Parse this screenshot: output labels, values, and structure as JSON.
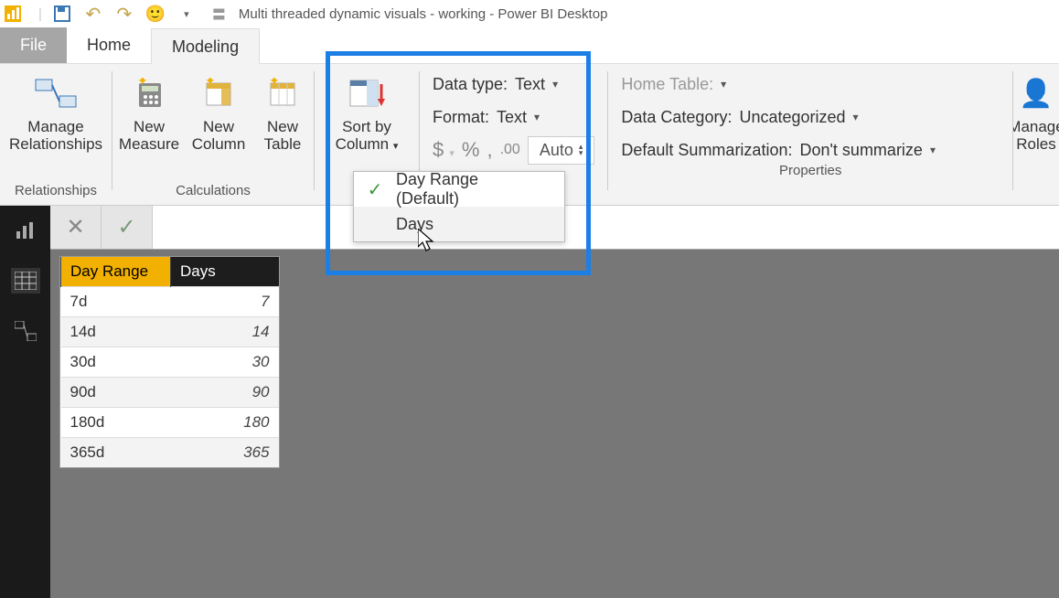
{
  "title": "Multi threaded dynamic visuals - working - Power BI Desktop",
  "tabs": {
    "file": "File",
    "home": "Home",
    "modeling": "Modeling"
  },
  "ribbon": {
    "relationships": {
      "manage": "Manage\nRelationships",
      "group": "Relationships"
    },
    "calculations": {
      "new_measure": "New\nMeasure",
      "new_column": "New\nColumn",
      "new_table": "New\nTable",
      "group": "Calculations"
    },
    "sort": {
      "label": "Sort by\nColumn",
      "menu": {
        "opt1": "Day Range (Default)",
        "opt2": "Days"
      }
    },
    "formatting": {
      "data_type_label": "Data type:",
      "data_type_value": "Text",
      "format_label": "Format:",
      "format_value": "Text",
      "auto": "Auto"
    },
    "properties": {
      "home_table": "Home Table:",
      "data_category_label": "Data Category:",
      "data_category_value": "Uncategorized",
      "summarization_label": "Default Summarization:",
      "summarization_value": "Don't summarize",
      "manage_roles": "Manage\nRoles",
      "group": "Properties"
    }
  },
  "table": {
    "col1": "Day Range",
    "col2": "Days",
    "rows": [
      {
        "range": "7d",
        "days": "7"
      },
      {
        "range": "14d",
        "days": "14"
      },
      {
        "range": "30d",
        "days": "30"
      },
      {
        "range": "90d",
        "days": "90"
      },
      {
        "range": "180d",
        "days": "180"
      },
      {
        "range": "365d",
        "days": "365"
      }
    ]
  }
}
